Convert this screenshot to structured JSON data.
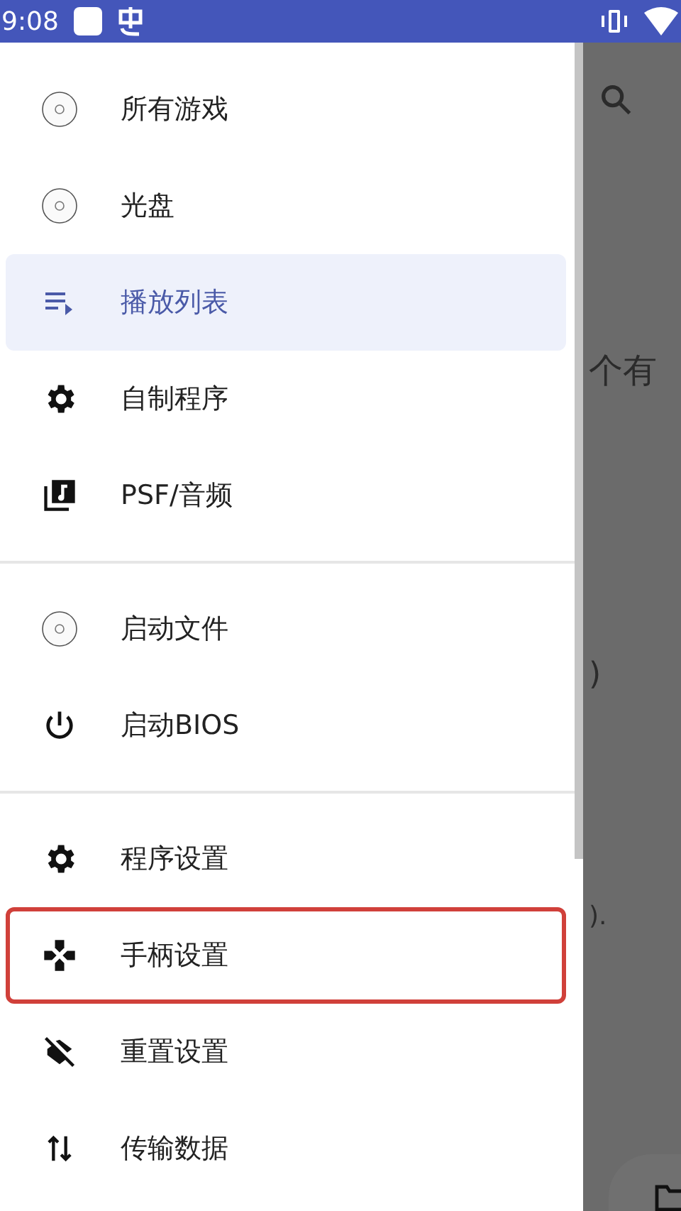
{
  "status_bar": {
    "time": "9:08"
  },
  "drawer": {
    "sections": [
      {
        "items": [
          {
            "kind": "disc",
            "label": "所有游戏",
            "selected": false,
            "highlighted": false
          },
          {
            "kind": "disc",
            "label": "光盘",
            "selected": false,
            "highlighted": false
          },
          {
            "kind": "playlist",
            "label": "播放列表",
            "selected": true,
            "highlighted": false
          },
          {
            "kind": "gear",
            "label": "自制程序",
            "selected": false,
            "highlighted": false
          },
          {
            "kind": "music",
            "label": "PSF/音频",
            "selected": false,
            "highlighted": false
          }
        ]
      },
      {
        "items": [
          {
            "kind": "disc",
            "label": "启动文件",
            "selected": false,
            "highlighted": false
          },
          {
            "kind": "power",
            "label": "启动BIOS",
            "selected": false,
            "highlighted": false
          }
        ]
      },
      {
        "items": [
          {
            "kind": "gear",
            "label": "程序设置",
            "selected": false,
            "highlighted": false
          },
          {
            "kind": "gamepad",
            "label": "手柄设置",
            "selected": false,
            "highlighted": true
          },
          {
            "kind": "layers-off",
            "label": "重置设置",
            "selected": false,
            "highlighted": false
          },
          {
            "kind": "swap",
            "label": "传输数据",
            "selected": false,
            "highlighted": false
          }
        ]
      }
    ]
  },
  "background": {
    "texts": [
      "个有",
      ")",
      ")."
    ]
  }
}
